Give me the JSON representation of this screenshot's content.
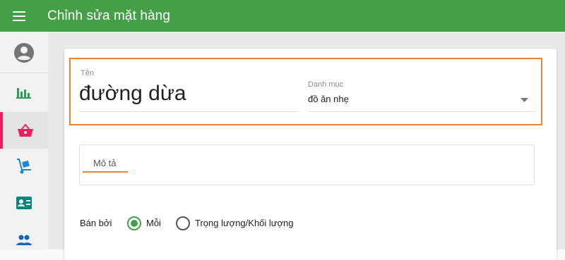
{
  "appbar": {
    "title": "Chỉnh sửa mặt hàng",
    "menu_icon": "menu-icon",
    "color": "#43a047"
  },
  "sidebar": {
    "items": [
      {
        "icon": "account-circle-icon",
        "active": false
      },
      {
        "icon": "bar-chart-icon",
        "active": false
      },
      {
        "icon": "basket-icon",
        "active": true
      },
      {
        "icon": "hand-truck-icon",
        "active": false
      },
      {
        "icon": "contact-card-icon",
        "active": false
      },
      {
        "icon": "people-icon",
        "active": false
      }
    ],
    "active_color": "#e91e63"
  },
  "form": {
    "name": {
      "label": "Tên",
      "value": "đường dừa"
    },
    "category": {
      "label": "Danh mục",
      "value": "đồ ăn nhẹ"
    },
    "description_tab": "Mô tả",
    "sold_by": {
      "label": "Bán bởi",
      "options": [
        {
          "label": "Mỗi",
          "checked": true
        },
        {
          "label": "Trọng lượng/Khối lượng",
          "checked": false
        }
      ]
    },
    "highlight_color": "#e8823a"
  }
}
